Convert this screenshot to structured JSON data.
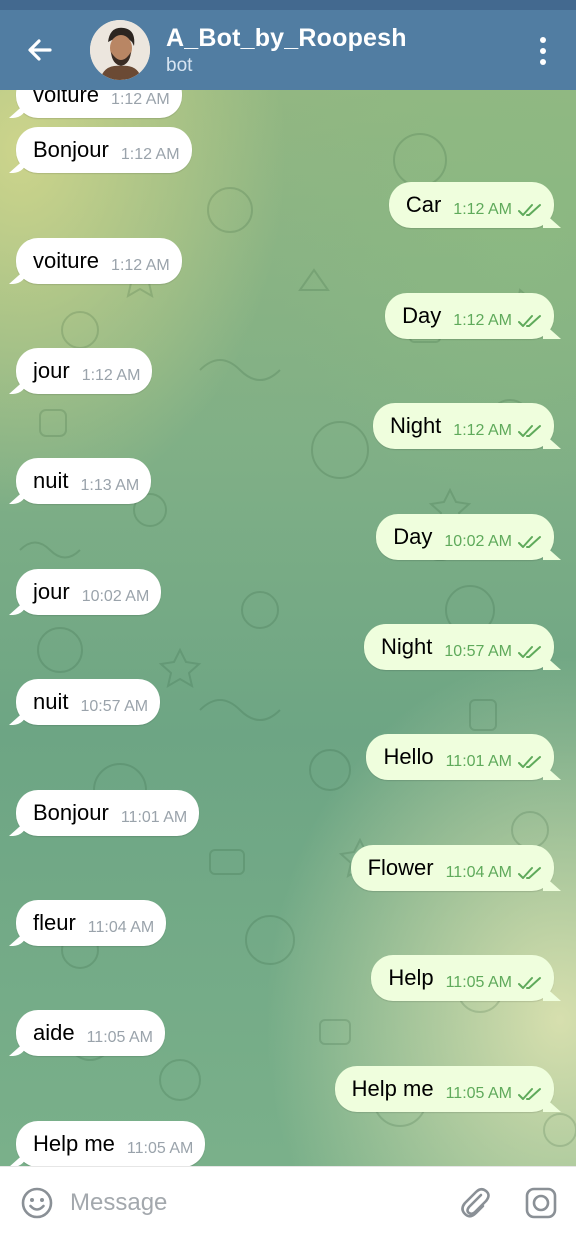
{
  "header": {
    "title": "A_Bot_by_Roopesh",
    "subtitle": "bot"
  },
  "colors": {
    "header": "#517da2",
    "incoming_bubble": "#ffffff",
    "outgoing_bubble": "#effedd",
    "outgoing_time": "#5faa5b",
    "incoming_time": "#9aa3ab"
  },
  "messages": [
    {
      "dir": "in",
      "text": "voiture",
      "time": "1:12 AM"
    },
    {
      "dir": "in",
      "text": "Bonjour",
      "time": "1:12 AM"
    },
    {
      "dir": "out",
      "text": "Car",
      "time": "1:12 AM",
      "status": "read"
    },
    {
      "dir": "in",
      "text": "voiture",
      "time": "1:12 AM"
    },
    {
      "dir": "out",
      "text": "Day",
      "time": "1:12 AM",
      "status": "read"
    },
    {
      "dir": "in",
      "text": "jour",
      "time": "1:12 AM"
    },
    {
      "dir": "out",
      "text": "Night",
      "time": "1:12 AM",
      "status": "read"
    },
    {
      "dir": "in",
      "text": "nuit",
      "time": "1:13 AM"
    },
    {
      "dir": "out",
      "text": "Day",
      "time": "10:02 AM",
      "status": "read"
    },
    {
      "dir": "in",
      "text": "jour",
      "time": "10:02 AM"
    },
    {
      "dir": "out",
      "text": "Night",
      "time": "10:57 AM",
      "status": "read"
    },
    {
      "dir": "in",
      "text": "nuit",
      "time": "10:57 AM"
    },
    {
      "dir": "out",
      "text": "Hello",
      "time": "11:01 AM",
      "status": "read"
    },
    {
      "dir": "in",
      "text": "Bonjour",
      "time": "11:01 AM"
    },
    {
      "dir": "out",
      "text": "Flower",
      "time": "11:04 AM",
      "status": "read"
    },
    {
      "dir": "in",
      "text": "fleur",
      "time": "11:04 AM"
    },
    {
      "dir": "out",
      "text": "Help",
      "time": "11:05 AM",
      "status": "read"
    },
    {
      "dir": "in",
      "text": "aide",
      "time": "11:05 AM"
    },
    {
      "dir": "out",
      "text": "Help me",
      "time": "11:05 AM",
      "status": "read"
    },
    {
      "dir": "in",
      "text": "Help me",
      "time": "11:05 AM"
    }
  ],
  "input": {
    "placeholder": "Message",
    "value": ""
  },
  "icons": {
    "back": "arrow-left-icon",
    "menu": "more-vertical-icon",
    "emoji": "smiley-icon",
    "attach": "paperclip-icon",
    "camera": "camera-icon",
    "read": "double-check-icon"
  }
}
